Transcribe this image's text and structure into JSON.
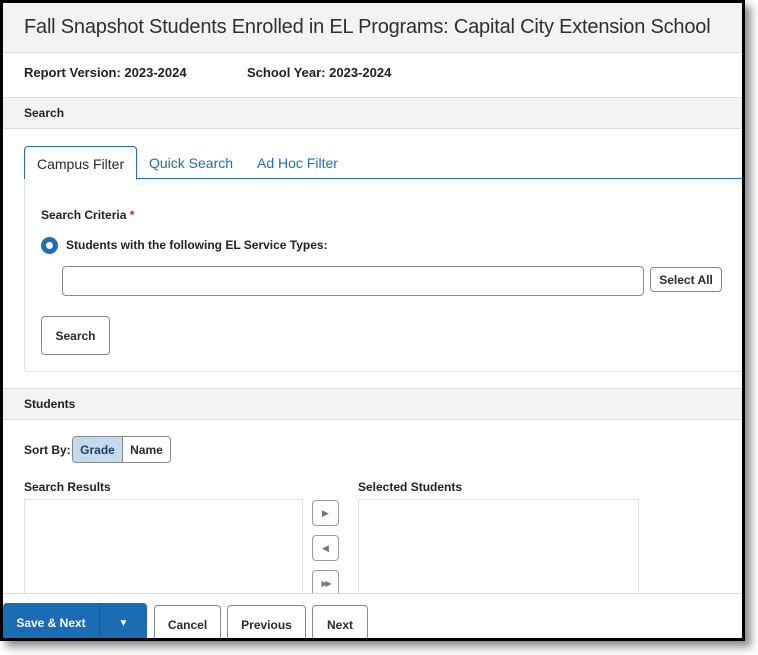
{
  "header": {
    "title": "Fall Snapshot Students Enrolled in EL Programs: Capital City Extension School",
    "report_version": "Report Version: 2023-2024",
    "school_year": "School Year: 2023-2024"
  },
  "search_section": {
    "heading": "Search",
    "tabs": [
      {
        "label": "Campus Filter",
        "active": true
      },
      {
        "label": "Quick Search",
        "active": false
      },
      {
        "label": "Ad Hoc Filter",
        "active": false
      }
    ],
    "criteria_label": "Search Criteria",
    "required_marker": "*",
    "radio_option_label": "Students with the following EL Service Types:",
    "radio_selected": true,
    "service_types_input_value": "",
    "select_all_label": "Select All",
    "search_button_label": "Search"
  },
  "students_section": {
    "heading": "Students",
    "sort_by_label": "Sort By:",
    "sort_options": [
      {
        "label": "Grade",
        "selected": true
      },
      {
        "label": "Name",
        "selected": false
      }
    ],
    "search_results_label": "Search Results",
    "selected_students_label": "Selected Students",
    "search_results": [],
    "selected_students": [],
    "transfer_buttons": [
      {
        "icon": "move-right-icon",
        "glyph": "▶"
      },
      {
        "icon": "move-left-icon",
        "glyph": "◀"
      },
      {
        "icon": "move-all-right-icon",
        "glyph": "▶▶"
      }
    ]
  },
  "footer": {
    "save_next_label": "Save & Next",
    "dropdown_glyph": "▼",
    "cancel_label": "Cancel",
    "previous_label": "Previous",
    "next_label": "Next"
  },
  "colors": {
    "accent": "#1a6db3",
    "sort_selected_bg": "#c2dbef",
    "required": "#c62828",
    "header_bg": "#f3f3f3"
  }
}
